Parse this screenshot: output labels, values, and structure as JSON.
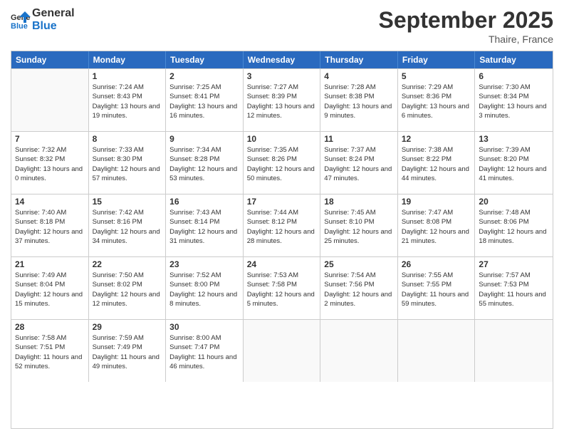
{
  "logo": {
    "line1": "General",
    "line2": "Blue"
  },
  "title": "September 2025",
  "location": "Thaire, France",
  "days_of_week": [
    "Sunday",
    "Monday",
    "Tuesday",
    "Wednesday",
    "Thursday",
    "Friday",
    "Saturday"
  ],
  "weeks": [
    [
      {
        "day": "",
        "empty": true
      },
      {
        "day": "1",
        "sunrise": "7:24 AM",
        "sunset": "8:43 PM",
        "daylight": "13 hours and 19 minutes."
      },
      {
        "day": "2",
        "sunrise": "7:25 AM",
        "sunset": "8:41 PM",
        "daylight": "13 hours and 16 minutes."
      },
      {
        "day": "3",
        "sunrise": "7:27 AM",
        "sunset": "8:39 PM",
        "daylight": "13 hours and 12 minutes."
      },
      {
        "day": "4",
        "sunrise": "7:28 AM",
        "sunset": "8:38 PM",
        "daylight": "13 hours and 9 minutes."
      },
      {
        "day": "5",
        "sunrise": "7:29 AM",
        "sunset": "8:36 PM",
        "daylight": "13 hours and 6 minutes."
      },
      {
        "day": "6",
        "sunrise": "7:30 AM",
        "sunset": "8:34 PM",
        "daylight": "13 hours and 3 minutes."
      }
    ],
    [
      {
        "day": "7",
        "sunrise": "7:32 AM",
        "sunset": "8:32 PM",
        "daylight": "13 hours and 0 minutes."
      },
      {
        "day": "8",
        "sunrise": "7:33 AM",
        "sunset": "8:30 PM",
        "daylight": "12 hours and 57 minutes."
      },
      {
        "day": "9",
        "sunrise": "7:34 AM",
        "sunset": "8:28 PM",
        "daylight": "12 hours and 53 minutes."
      },
      {
        "day": "10",
        "sunrise": "7:35 AM",
        "sunset": "8:26 PM",
        "daylight": "12 hours and 50 minutes."
      },
      {
        "day": "11",
        "sunrise": "7:37 AM",
        "sunset": "8:24 PM",
        "daylight": "12 hours and 47 minutes."
      },
      {
        "day": "12",
        "sunrise": "7:38 AM",
        "sunset": "8:22 PM",
        "daylight": "12 hours and 44 minutes."
      },
      {
        "day": "13",
        "sunrise": "7:39 AM",
        "sunset": "8:20 PM",
        "daylight": "12 hours and 41 minutes."
      }
    ],
    [
      {
        "day": "14",
        "sunrise": "7:40 AM",
        "sunset": "8:18 PM",
        "daylight": "12 hours and 37 minutes."
      },
      {
        "day": "15",
        "sunrise": "7:42 AM",
        "sunset": "8:16 PM",
        "daylight": "12 hours and 34 minutes."
      },
      {
        "day": "16",
        "sunrise": "7:43 AM",
        "sunset": "8:14 PM",
        "daylight": "12 hours and 31 minutes."
      },
      {
        "day": "17",
        "sunrise": "7:44 AM",
        "sunset": "8:12 PM",
        "daylight": "12 hours and 28 minutes."
      },
      {
        "day": "18",
        "sunrise": "7:45 AM",
        "sunset": "8:10 PM",
        "daylight": "12 hours and 25 minutes."
      },
      {
        "day": "19",
        "sunrise": "7:47 AM",
        "sunset": "8:08 PM",
        "daylight": "12 hours and 21 minutes."
      },
      {
        "day": "20",
        "sunrise": "7:48 AM",
        "sunset": "8:06 PM",
        "daylight": "12 hours and 18 minutes."
      }
    ],
    [
      {
        "day": "21",
        "sunrise": "7:49 AM",
        "sunset": "8:04 PM",
        "daylight": "12 hours and 15 minutes."
      },
      {
        "day": "22",
        "sunrise": "7:50 AM",
        "sunset": "8:02 PM",
        "daylight": "12 hours and 12 minutes."
      },
      {
        "day": "23",
        "sunrise": "7:52 AM",
        "sunset": "8:00 PM",
        "daylight": "12 hours and 8 minutes."
      },
      {
        "day": "24",
        "sunrise": "7:53 AM",
        "sunset": "7:58 PM",
        "daylight": "12 hours and 5 minutes."
      },
      {
        "day": "25",
        "sunrise": "7:54 AM",
        "sunset": "7:56 PM",
        "daylight": "12 hours and 2 minutes."
      },
      {
        "day": "26",
        "sunrise": "7:55 AM",
        "sunset": "7:55 PM",
        "daylight": "11 hours and 59 minutes."
      },
      {
        "day": "27",
        "sunrise": "7:57 AM",
        "sunset": "7:53 PM",
        "daylight": "11 hours and 55 minutes."
      }
    ],
    [
      {
        "day": "28",
        "sunrise": "7:58 AM",
        "sunset": "7:51 PM",
        "daylight": "11 hours and 52 minutes."
      },
      {
        "day": "29",
        "sunrise": "7:59 AM",
        "sunset": "7:49 PM",
        "daylight": "11 hours and 49 minutes."
      },
      {
        "day": "30",
        "sunrise": "8:00 AM",
        "sunset": "7:47 PM",
        "daylight": "11 hours and 46 minutes."
      },
      {
        "day": "",
        "empty": true
      },
      {
        "day": "",
        "empty": true
      },
      {
        "day": "",
        "empty": true
      },
      {
        "day": "",
        "empty": true
      }
    ]
  ]
}
